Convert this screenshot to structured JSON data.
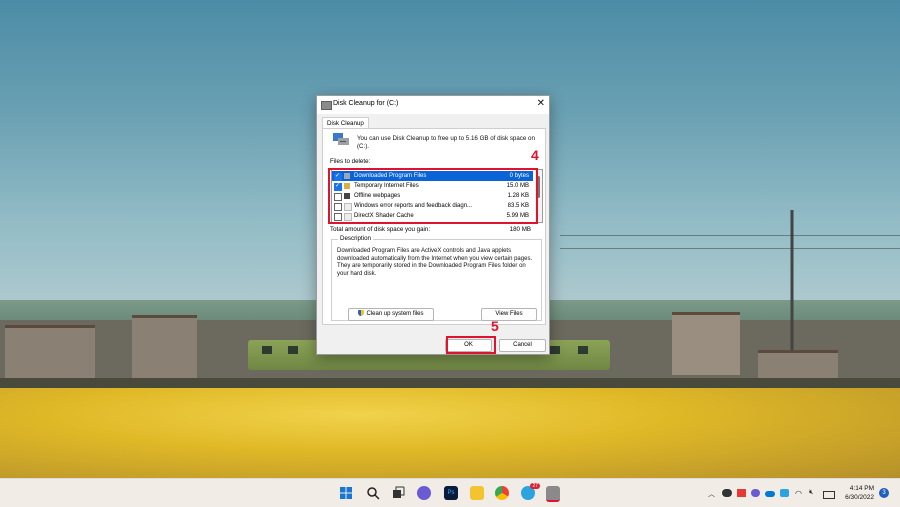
{
  "dialog": {
    "title": "Disk Cleanup for  (C:)",
    "close_glyph": "✕",
    "tab": "Disk Cleanup",
    "intro": "You can use Disk Cleanup to free up to 5.16 GB of disk space on (C:).",
    "files_label": "Files to delete:",
    "files": [
      {
        "name": "Downloaded Program Files",
        "size": "0 bytes",
        "checked": true,
        "selected": true
      },
      {
        "name": "Temporary Internet Files",
        "size": "15.0 MB",
        "checked": true,
        "selected": false
      },
      {
        "name": "Offline webpages",
        "size": "1.28 KB",
        "checked": false,
        "selected": false
      },
      {
        "name": "Windows error reports and feedback diagn...",
        "size": "83.5 KB",
        "checked": false,
        "selected": false
      },
      {
        "name": "DirectX Shader Cache",
        "size": "5.99 MB",
        "checked": false,
        "selected": false
      }
    ],
    "total_label": "Total amount of disk space you gain:",
    "total_value": "180 MB",
    "description_label": "Description",
    "description": "Downloaded Program Files are ActiveX controls and Java applets downloaded automatically from the Internet when you view certain pages. They are temporarily stored in the Downloaded Program Files folder on your hard disk.",
    "cleanup_system_button": "Clean up system files",
    "view_files_button": "View Files",
    "ok_button": "OK",
    "cancel_button": "Cancel"
  },
  "callouts": {
    "list": "4",
    "ok": "5"
  },
  "taskbar": {
    "apps": [
      {
        "icon": "windows-start-icon",
        "color": "#1976d2"
      },
      {
        "icon": "search-icon",
        "color": "#222222"
      },
      {
        "icon": "task-view-icon",
        "color": "#333333"
      },
      {
        "icon": "chat-icon",
        "color": "#6b5bd2"
      },
      {
        "icon": "photoshop-icon",
        "color": "#0a1b3d"
      },
      {
        "icon": "file-explorer-icon",
        "color": "#f4c430"
      },
      {
        "icon": "chrome-icon",
        "color": "#34a853"
      },
      {
        "icon": "telegram-icon",
        "color": "#2aa3df"
      },
      {
        "icon": "disk-cleanup-icon",
        "color": "#8a8a8a"
      }
    ],
    "telegram_badge": "27",
    "time": "4:14 PM",
    "date": "6/30/2022",
    "notifications": "3"
  }
}
